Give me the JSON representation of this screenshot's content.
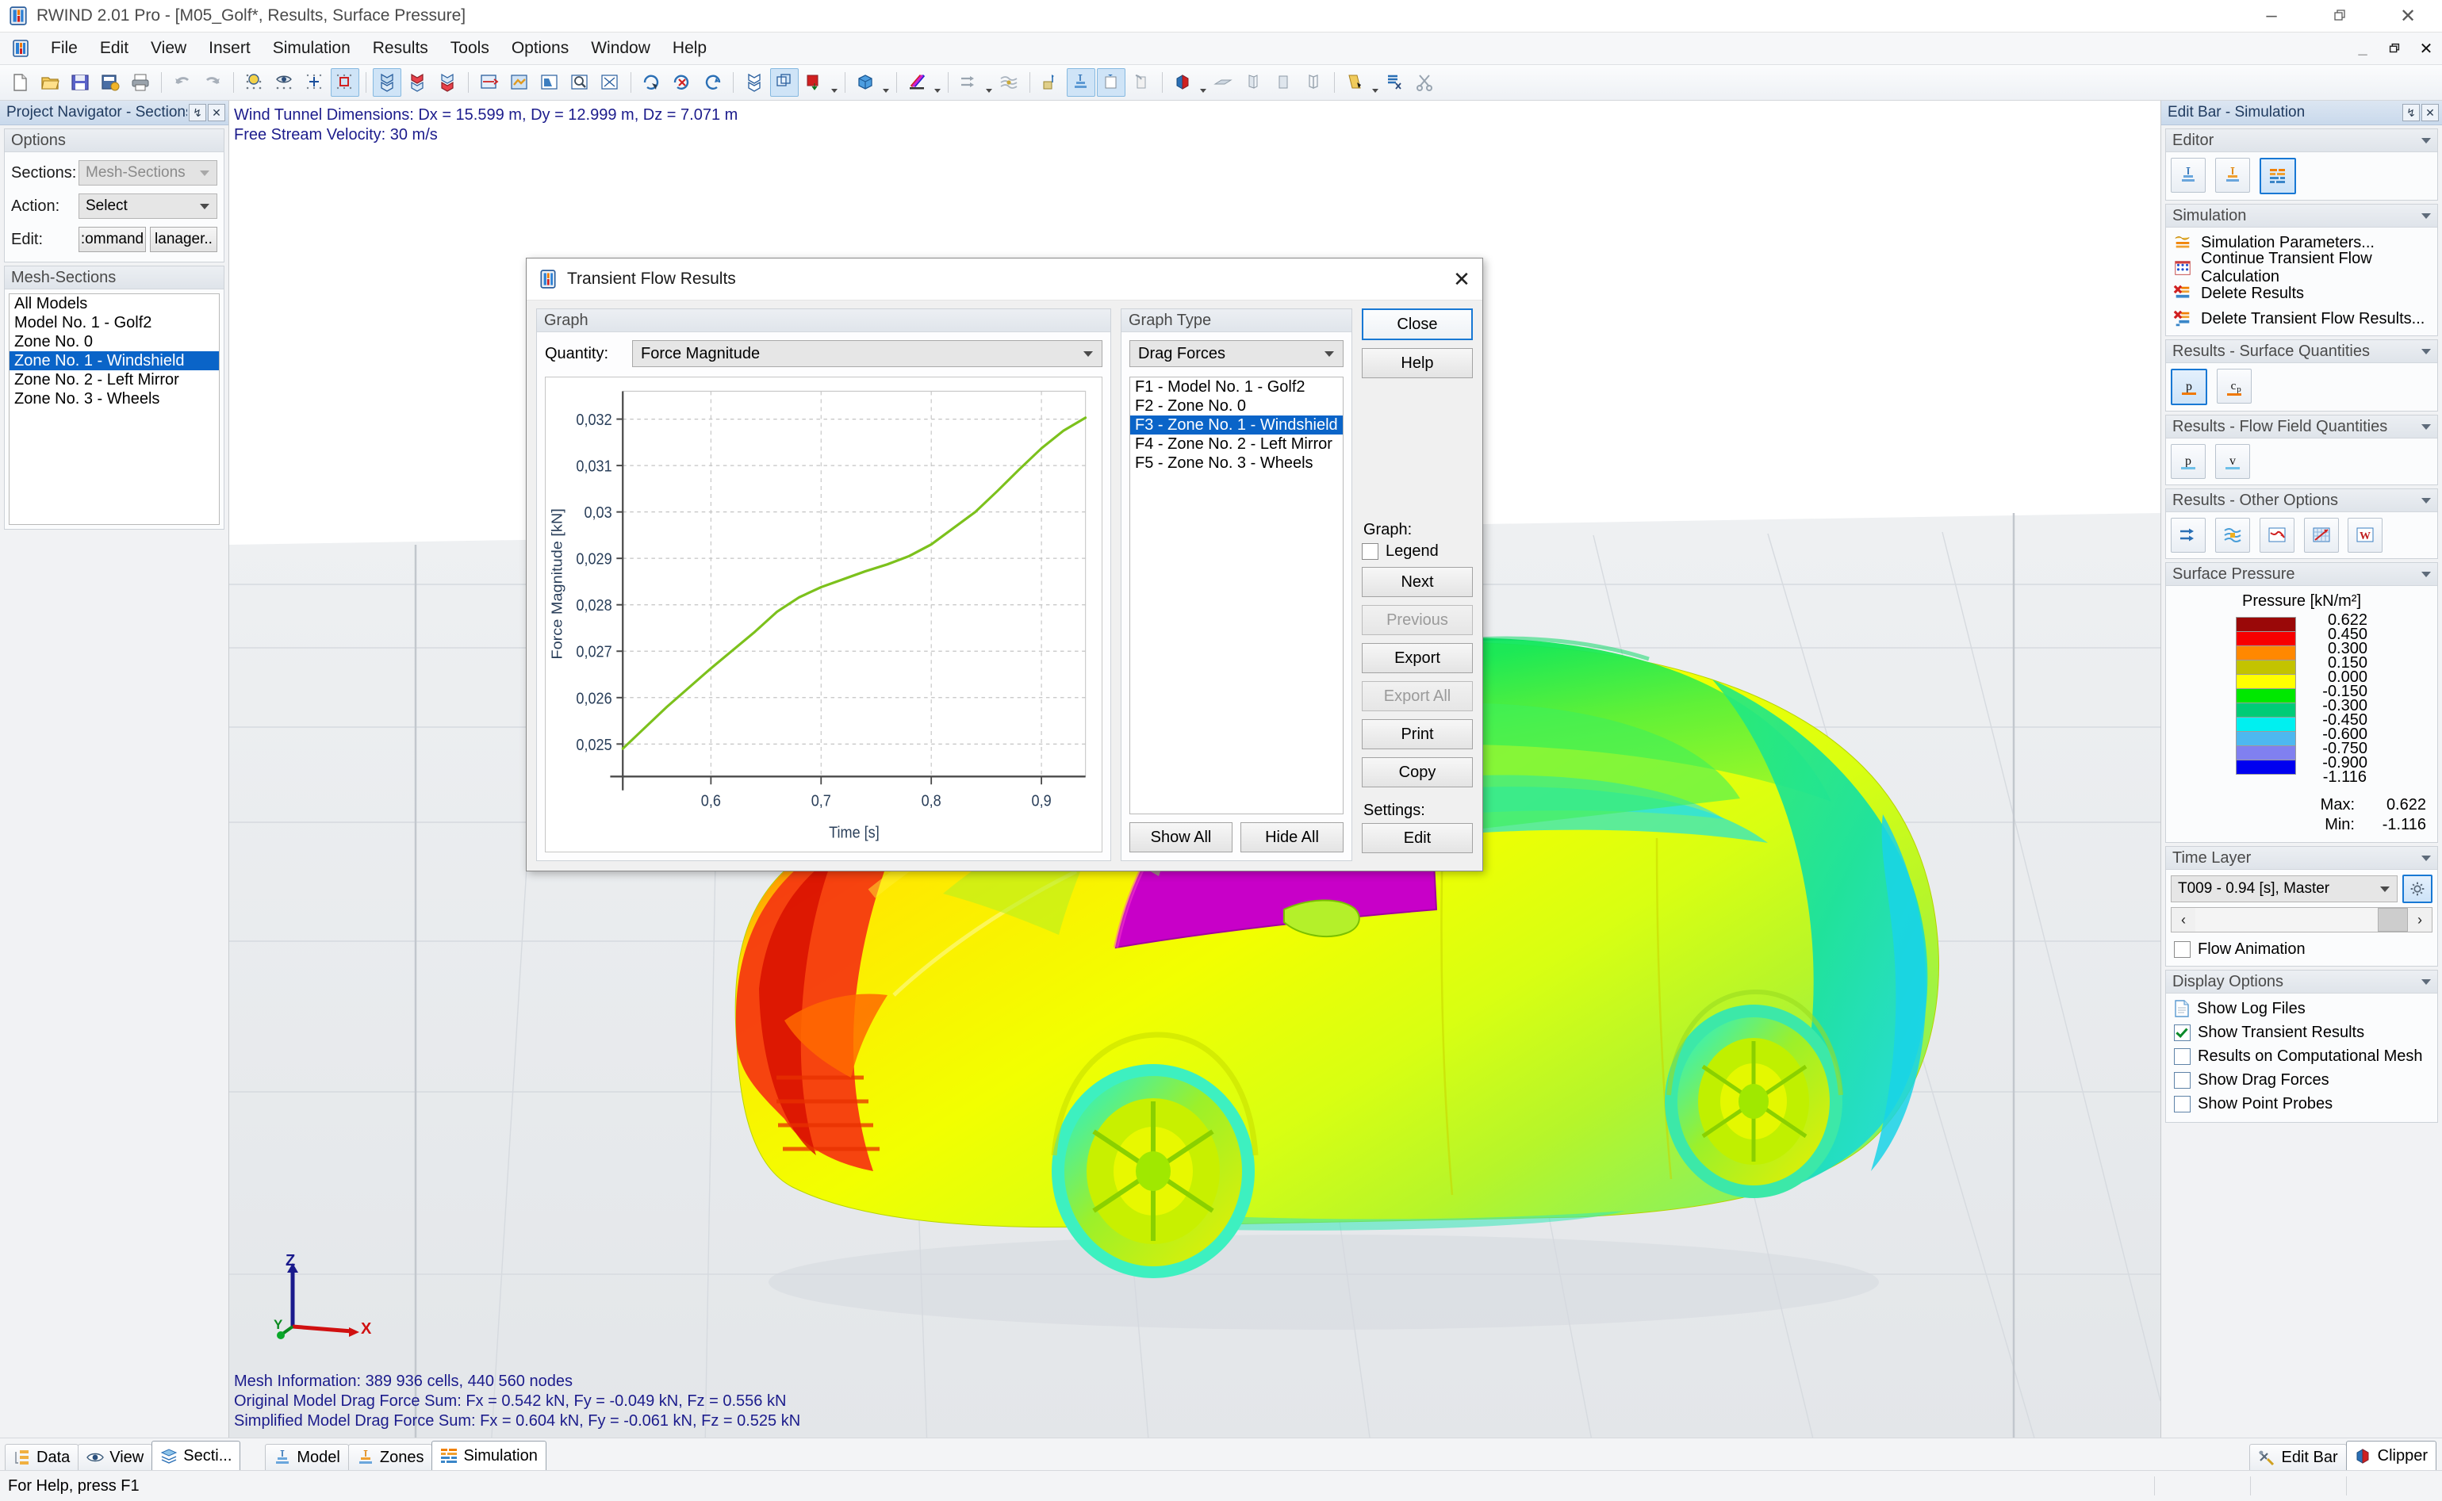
{
  "window": {
    "title": "RWIND 2.01 Pro - [M05_Golf*, Results, Surface Pressure]",
    "minimize": "–",
    "restore": "❐",
    "close": "✕",
    "mdi_minimize": "_",
    "mdi_restore": "❐",
    "mdi_close": "✕"
  },
  "menu": {
    "items": [
      "File",
      "Edit",
      "View",
      "Insert",
      "Simulation",
      "Results",
      "Tools",
      "Options",
      "Window",
      "Help"
    ]
  },
  "toolbar": {
    "groups": [
      [
        "new-file-icon",
        "open-folder-icon",
        "save-icon",
        "save-as-icon",
        "print-icon"
      ],
      [
        "undo-icon",
        "redo-icon"
      ],
      [
        "render-quality-icon",
        "visibility-icon",
        "snap-grid-icon",
        "selection-box-icon"
      ],
      [
        "model-view-icon",
        "model-view-2-icon",
        "model-view-3-icon"
      ],
      [
        "section-cut-icon",
        "layers-icon",
        "shadow-icon",
        "zoom-window-icon",
        "zoom-fit-icon"
      ],
      [
        "rotate-view-icon",
        "reset-view-icon",
        "rotate-ccw-icon"
      ],
      [
        "wireframe-icon",
        "solid-view-icon",
        "perspective-icon"
      ],
      [
        "box-view-icon",
        "colors-icon"
      ],
      [
        "flow-arrows-icon",
        "streamlines-icon",
        "probe-icon",
        "model-tab-icon",
        "zones-tab-icon",
        "copy-model-icon"
      ],
      [
        "clipper-icon",
        "plane-icon",
        "slice-icon",
        "panel-icon",
        "mesh-panel-icon"
      ],
      [
        "select-tool-icon",
        "cut-tool-icon",
        "scissors-icon"
      ]
    ]
  },
  "left_panel": {
    "title": "Project Navigator  - Sections",
    "pin": "↯",
    "close": "✕",
    "options_group": "Options",
    "sections_label": "Sections:",
    "sections_value": "Mesh-Sections",
    "action_label": "Action:",
    "action_value": "Select",
    "edit_label": "Edit:",
    "edit_buttons": [
      ":ommand",
      "lanager.."
    ],
    "mesh_sections_group": "Mesh-Sections",
    "mesh_sections": [
      {
        "label": "All Models",
        "selected": false
      },
      {
        "label": "Model No. 1 - Golf2",
        "selected": false
      },
      {
        "label": "Zone No. 0",
        "selected": false
      },
      {
        "label": "Zone No. 1 - Windshield",
        "selected": true
      },
      {
        "label": "Zone No. 2 - Left Mirror",
        "selected": false
      },
      {
        "label": "Zone No. 3 - Wheels",
        "selected": false
      }
    ]
  },
  "viewport": {
    "top_lines": [
      "Wind Tunnel Dimensions: Dx = 15.599 m, Dy = 12.999 m, Dz = 7.071 m",
      "Free Stream Velocity: 30 m/s"
    ],
    "bottom_lines": [
      "Mesh Information: 389 936 cells, 440 560 nodes",
      "Original Model Drag Force Sum: Fx = 0.542 kN, Fy = -0.049 kN, Fz = 0.556 kN",
      "Simplified Model Drag Force Sum: Fx = 0.604 kN, Fy = -0.061 kN, Fz = 0.525 kN"
    ],
    "axes": {
      "x": "X",
      "y": "Y",
      "z": "Z"
    }
  },
  "dialog": {
    "title": "Transient Flow Results",
    "close_glyph": "✕",
    "graph_group": "Graph",
    "quantity_label": "Quantity:",
    "quantity_value": "Force Magnitude",
    "graph_type_group": "Graph Type",
    "graph_type_value": "Drag Forces",
    "function_list": [
      {
        "label": "F1 - Model No. 1 - Golf2",
        "selected": false
      },
      {
        "label": "F2 - Zone No. 0",
        "selected": false
      },
      {
        "label": "F3 - Zone No. 1 - Windshield",
        "selected": true
      },
      {
        "label": "F4 - Zone No. 2 - Left Mirror",
        "selected": false
      },
      {
        "label": "F5 - Zone No. 3 - Wheels",
        "selected": false
      }
    ],
    "show_all": "Show All",
    "hide_all": "Hide All",
    "close_button": "Close",
    "help_button": "Help",
    "graph_label": "Graph:",
    "legend_checkbox": "Legend",
    "legend_checked": false,
    "next_button": "Next",
    "previous_button": "Previous",
    "export_button": "Export",
    "export_all_button": "Export All",
    "print_button": "Print",
    "copy_button": "Copy",
    "settings_label": "Settings:",
    "edit_button": "Edit"
  },
  "chart_data": {
    "type": "line",
    "title": "",
    "xlabel": "Time [s]",
    "ylabel": "Force Magnitude [kN]",
    "xlim": [
      0.52,
      0.94
    ],
    "ylim": [
      0.0243,
      0.0326
    ],
    "xticks": [
      "0,6",
      "0,7",
      "0,8",
      "0,9"
    ],
    "xtick_values": [
      0.6,
      0.7,
      0.8,
      0.9
    ],
    "yticks": [
      "0,025",
      "0,026",
      "0,027",
      "0,028",
      "0,029",
      "0,03",
      "0,031",
      "0,032"
    ],
    "ytick_values": [
      0.025,
      0.026,
      0.027,
      0.028,
      0.029,
      0.03,
      0.031,
      0.032
    ],
    "grid": true,
    "legend": false,
    "series": [
      {
        "name": "F3 - Zone No. 1 - Windshield",
        "color": "#7cc11c",
        "x": [
          0.52,
          0.56,
          0.6,
          0.64,
          0.66,
          0.68,
          0.7,
          0.72,
          0.74,
          0.76,
          0.78,
          0.8,
          0.82,
          0.84,
          0.86,
          0.88,
          0.9,
          0.92,
          0.94
        ],
        "y": [
          0.0249,
          0.0258,
          0.02663,
          0.02742,
          0.02785,
          0.02816,
          0.02838,
          0.02855,
          0.02872,
          0.02887,
          0.02905,
          0.0293,
          0.02965,
          0.03,
          0.03045,
          0.03092,
          0.03137,
          0.03175,
          0.03203
        ]
      }
    ]
  },
  "right_panel": {
    "title": "Edit Bar - Simulation",
    "pin": "↯",
    "close": "✕",
    "editor_group": "Editor",
    "editor_buttons": [
      "model-icon",
      "zones-icon",
      "simulation-icon"
    ],
    "editor_active_index": 2,
    "simulation_group": "Simulation",
    "simulation_items": [
      {
        "label": "Simulation Parameters...",
        "icon": "parameters-icon"
      },
      {
        "label": "Continue Transient Flow Calculation",
        "icon": "continue-calc-icon"
      },
      {
        "label": "Delete Results",
        "icon": "delete-results-icon"
      },
      {
        "label": "Delete Transient Flow Results...",
        "icon": "delete-transient-icon"
      }
    ],
    "surface_quantities_group": "Results - Surface Quantities",
    "surface_quantities": [
      {
        "label": "p",
        "active": true
      },
      {
        "label": "cp",
        "active": false
      }
    ],
    "flow_field_group": "Results - Flow Field Quantities",
    "flow_field": [
      {
        "label": "p",
        "active": false
      },
      {
        "label": "v",
        "active": false
      }
    ],
    "other_options_group": "Results - Other Options",
    "other_options_icons": [
      "flow-arrows-icon",
      "streamlines-icon",
      "graph-icon",
      "diagram-icon",
      "word-export-icon"
    ],
    "surface_pressure_group": "Surface Pressure",
    "legend_title": "Pressure [kN/m²]",
    "legend_colors": [
      "#9a0808",
      "#f70000",
      "#ff8800",
      "#c3c300",
      "#ffff00",
      "#00e800",
      "#00cc77",
      "#00f0f0",
      "#4db8f0",
      "#8080f0",
      "#0000f0"
    ],
    "legend_values": [
      "0.622",
      "0.450",
      "0.300",
      "0.150",
      "0.000",
      "-0.150",
      "-0.300",
      "-0.450",
      "-0.600",
      "-0.750",
      "-0.900",
      "-1.116"
    ],
    "max_label": "Max:",
    "max_value": "0.622",
    "min_label": "Min:",
    "min_value": "-1.116",
    "time_layer_group": "Time Layer",
    "time_layer_value": "T009 - 0.94 [s], Master",
    "time_layer_settings_icon": "gear-icon",
    "slider_prev": "‹",
    "slider_next": "›",
    "flow_animation_label": "Flow Animation",
    "flow_animation_checked": false,
    "display_options_group": "Display Options",
    "display_options": [
      {
        "label": "Show Log Files",
        "checked": false,
        "icon": "log-file-icon"
      },
      {
        "label": "Show Transient Results",
        "checked": true,
        "icon": "checkbox-icon"
      },
      {
        "label": "Results on Computational Mesh",
        "checked": false,
        "icon": "checkbox-icon"
      },
      {
        "label": "Show Drag Forces",
        "checked": false,
        "icon": "checkbox-icon"
      },
      {
        "label": "Show Point Probes",
        "checked": false,
        "icon": "checkbox-icon"
      }
    ]
  },
  "bottom": {
    "left_tabs": [
      {
        "label": "Data",
        "icon": "data-icon",
        "active": false
      },
      {
        "label": "View",
        "icon": "eye-icon",
        "active": false
      },
      {
        "label": "Secti...",
        "icon": "sections-icon",
        "active": true
      }
    ],
    "center_tabs": [
      {
        "label": "Model",
        "icon": "model-icon",
        "active": false
      },
      {
        "label": "Zones",
        "icon": "zones-icon",
        "active": false
      },
      {
        "label": "Simulation",
        "icon": "simulation-icon",
        "active": true
      }
    ],
    "right_tabs": [
      {
        "label": "Edit Bar",
        "icon": "tools-icon",
        "active": false
      },
      {
        "label": "Clipper",
        "icon": "clipper-icon",
        "active": true
      }
    ],
    "status_text": "For Help, press F1"
  }
}
